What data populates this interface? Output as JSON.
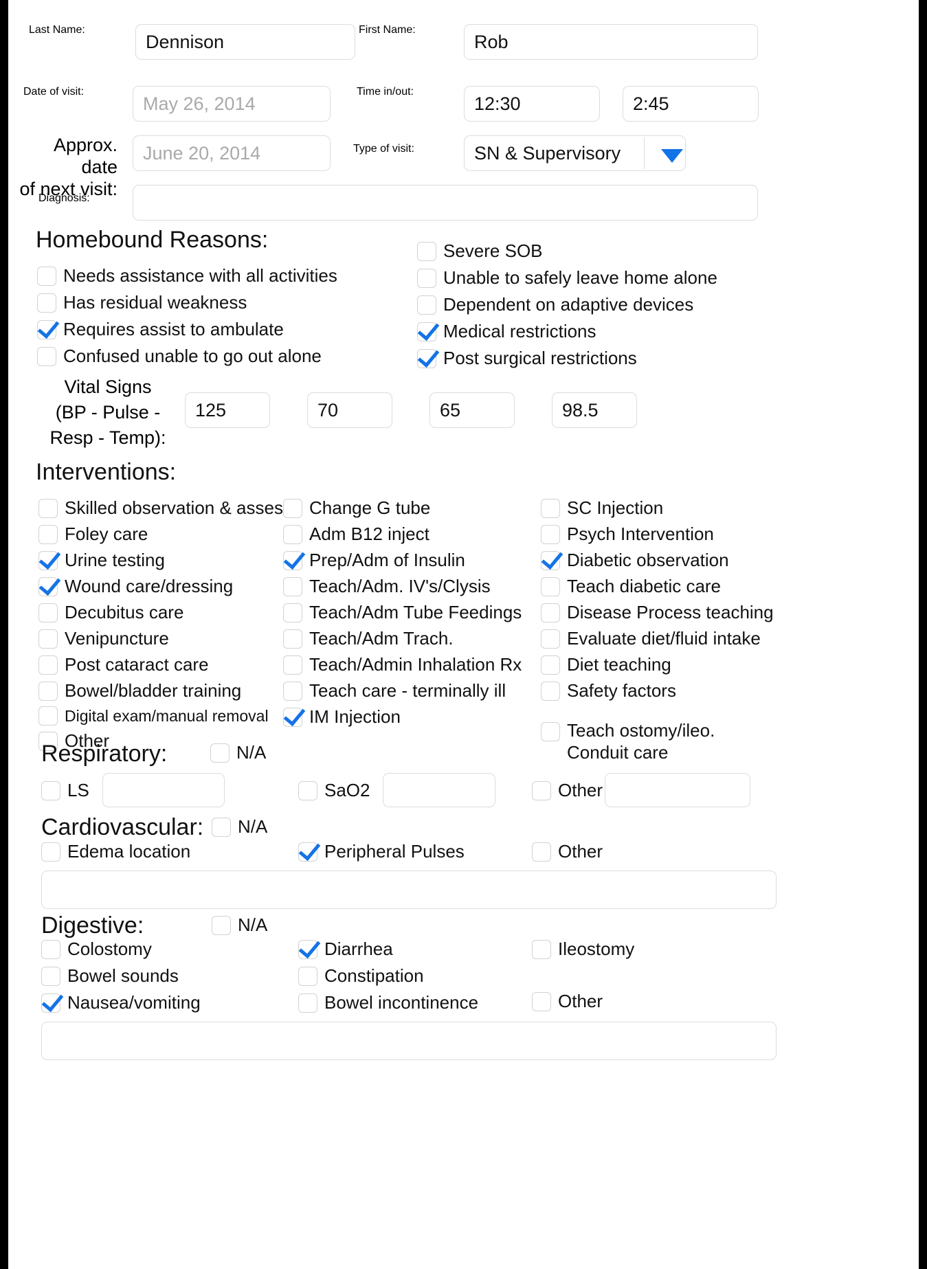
{
  "header": {
    "last_name_label": "Last Name:",
    "last_name_value": "Dennison",
    "first_name_label": "First Name:",
    "first_name_value": "Rob",
    "date_of_visit_label": "Date of visit:",
    "date_of_visit_placeholder": "May 26, 2014",
    "time_in_out_label": "Time in/out:",
    "time_in_value": "12:30",
    "time_out_value": "2:45",
    "next_visit_label_line1": "Approx. date",
    "next_visit_label_line2": "of next visit:",
    "next_visit_placeholder": "June 20, 2014",
    "type_of_visit_label": "Type of visit:",
    "type_of_visit_value": "SN & Supervisory",
    "diagnosis_label": "Diagnosis:",
    "diagnosis_value": ""
  },
  "homebound": {
    "title": "Homebound Reasons:",
    "left": [
      {
        "label": "Needs assistance with all activities",
        "checked": false
      },
      {
        "label": "Has residual weakness",
        "checked": false
      },
      {
        "label": "Requires assist to ambulate",
        "checked": true
      },
      {
        "label": "Confused unable to go out alone",
        "checked": false
      }
    ],
    "right": [
      {
        "label": "Severe SOB",
        "checked": false
      },
      {
        "label": "Unable to safely leave home alone",
        "checked": false
      },
      {
        "label": "Dependent on adaptive devices",
        "checked": false
      },
      {
        "label": "Medical restrictions",
        "checked": true
      },
      {
        "label": "Post surgical restrictions",
        "checked": true
      }
    ]
  },
  "vitals": {
    "label_line1": "Vital Signs",
    "label_line2": "(BP - Pulse -",
    "label_line3": "Resp - Temp):",
    "bp_systolic": "125",
    "bp_diastolic": "70",
    "pulse": "65",
    "temp": "98.5"
  },
  "interventions": {
    "title": "Interventions:",
    "col1": [
      {
        "label": "Skilled observation & assess",
        "checked": false
      },
      {
        "label": "Foley care",
        "checked": false
      },
      {
        "label": "Urine testing",
        "checked": true
      },
      {
        "label": "Wound care/dressing",
        "checked": true
      },
      {
        "label": "Decubitus care",
        "checked": false
      },
      {
        "label": "Venipuncture",
        "checked": false
      },
      {
        "label": "Post cataract care",
        "checked": false
      },
      {
        "label": "Bowel/bladder training",
        "checked": false
      },
      {
        "label": "Digital exam/manual removal",
        "checked": false
      },
      {
        "label": "Other",
        "checked": false
      }
    ],
    "col2": [
      {
        "label": "Change G tube",
        "checked": false
      },
      {
        "label": "Adm B12 inject",
        "checked": false
      },
      {
        "label": "Prep/Adm of Insulin",
        "checked": true
      },
      {
        "label": "Teach/Adm. IV's/Clysis",
        "checked": false
      },
      {
        "label": "Teach/Adm Tube Feedings",
        "checked": false
      },
      {
        "label": "Teach/Adm Trach.",
        "checked": false
      },
      {
        "label": "Teach/Admin Inhalation Rx",
        "checked": false
      },
      {
        "label": "Teach care - terminally ill",
        "checked": false
      },
      {
        "label": "IM Injection",
        "checked": true
      }
    ],
    "col3": [
      {
        "label": "SC Injection",
        "checked": false
      },
      {
        "label": "Psych Intervention",
        "checked": false
      },
      {
        "label": "Diabetic observation",
        "checked": true
      },
      {
        "label": "Teach diabetic care",
        "checked": false
      },
      {
        "label": "Disease Process teaching",
        "checked": false
      },
      {
        "label": "Evaluate diet/fluid intake",
        "checked": false
      },
      {
        "label": "Diet teaching",
        "checked": false
      },
      {
        "label": "Safety factors",
        "checked": false
      }
    ],
    "col3_last": {
      "label_line1": "Teach ostomy/ileo.",
      "label_line2": "Conduit care",
      "checked": false
    }
  },
  "respiratory": {
    "title": "Respiratory:",
    "na_label": "N/A",
    "na_checked": false,
    "ls_label": "LS",
    "ls_checked": false,
    "ls_value": "",
    "sao2_label": "SaO2",
    "sao2_checked": false,
    "sao2_value": "",
    "other_label": "Other",
    "other_checked": false,
    "other_value": ""
  },
  "cardiovascular": {
    "title": "Cardiovascular:",
    "na_label": "N/A",
    "na_checked": false,
    "edema_label": "Edema location",
    "edema_checked": false,
    "pulses_label": "Peripheral Pulses",
    "pulses_checked": true,
    "other_label": "Other",
    "other_checked": false,
    "notes_value": ""
  },
  "digestive": {
    "title": "Digestive:",
    "na_label": "N/A",
    "na_checked": false,
    "col1": [
      {
        "label": "Colostomy",
        "checked": false
      },
      {
        "label": "Bowel sounds",
        "checked": false
      },
      {
        "label": "Nausea/vomiting",
        "checked": true
      }
    ],
    "col2": [
      {
        "label": "Diarrhea",
        "checked": true
      },
      {
        "label": "Constipation",
        "checked": false
      },
      {
        "label": "Bowel incontinence",
        "checked": false
      }
    ],
    "col3": [
      {
        "label": "Ileostomy",
        "checked": false
      },
      {
        "label": "Other",
        "checked": false
      }
    ],
    "notes_value": ""
  },
  "colors": {
    "accent": "#1473e6",
    "border": "#dcdcdc",
    "placeholder": "#a9a9a9"
  }
}
